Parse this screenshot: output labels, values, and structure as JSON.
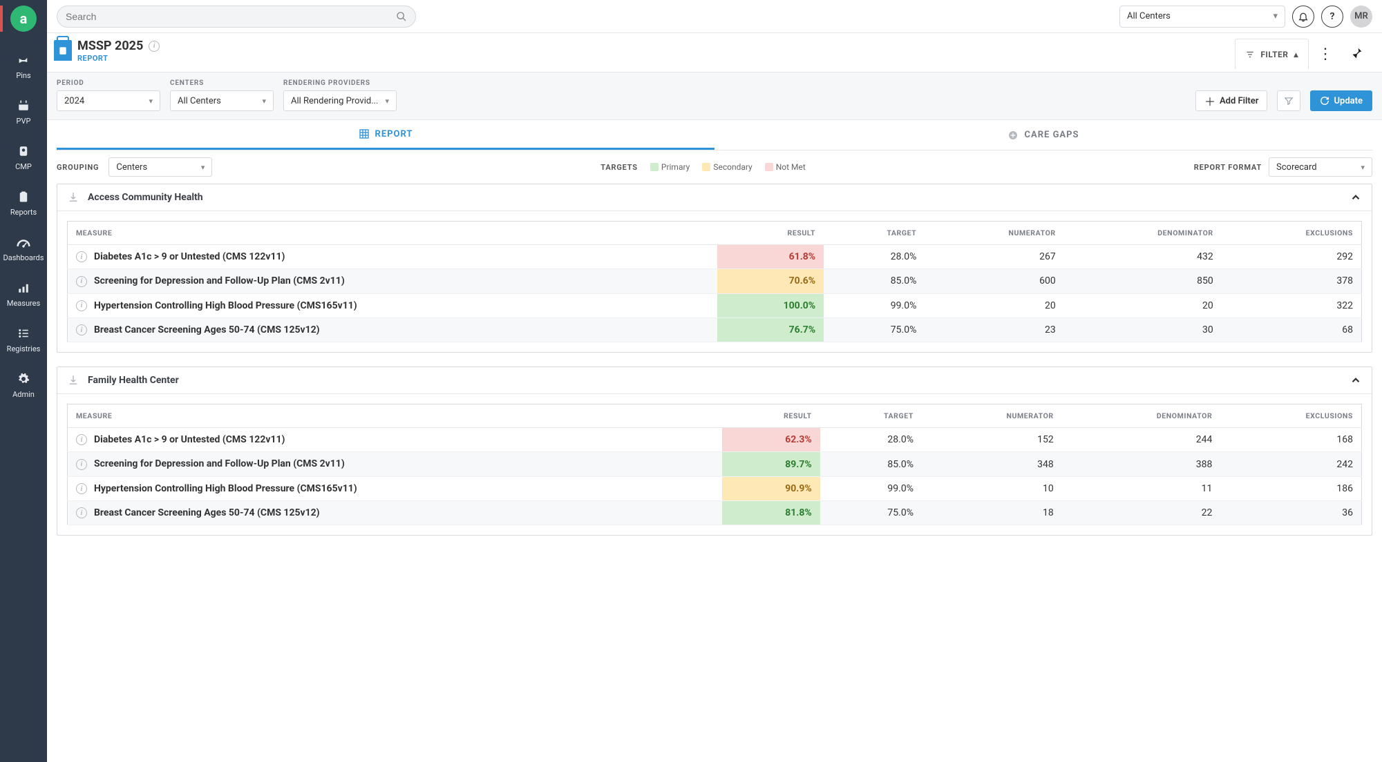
{
  "colors": {
    "primary": "#cfeccc",
    "secondary": "#fee8b6",
    "notmet": "#f9d7d6",
    "accent": "#2f93d8"
  },
  "sidebar": {
    "items": [
      {
        "label": "Pins"
      },
      {
        "label": "PVP"
      },
      {
        "label": "CMP"
      },
      {
        "label": "Reports"
      },
      {
        "label": "Dashboards"
      },
      {
        "label": "Measures"
      },
      {
        "label": "Registries"
      },
      {
        "label": "Admin"
      }
    ]
  },
  "topbar": {
    "search_placeholder": "Search",
    "center_select": "All Centers",
    "avatar": "MR"
  },
  "title": {
    "name": "MSSP 2025",
    "type": "REPORT",
    "filter_label": "FILTER"
  },
  "filters": {
    "period": {
      "label": "PERIOD",
      "value": "2024"
    },
    "centers": {
      "label": "CENTERS",
      "value": "All Centers"
    },
    "providers": {
      "label": "RENDERING PROVIDERS",
      "value": "All Rendering Provid..."
    },
    "add_filter": "Add Filter",
    "update": "Update"
  },
  "tabs": {
    "report": "REPORT",
    "care_gaps": "CARE GAPS"
  },
  "controls": {
    "grouping_label": "GROUPING",
    "grouping_value": "Centers",
    "targets_label": "TARGETS",
    "legend": {
      "primary": "Primary",
      "secondary": "Secondary",
      "notmet": "Not Met"
    },
    "format_label": "REPORT FORMAT",
    "format_value": "Scorecard"
  },
  "columns": {
    "measure": "MEASURE",
    "result": "RESULT",
    "target": "TARGET",
    "numerator": "NUMERATOR",
    "denominator": "DENOMINATOR",
    "exclusions": "EXCLUSIONS"
  },
  "groups": [
    {
      "name": "Access Community Health",
      "rows": [
        {
          "name": "Diabetes A1c > 9 or Untested (CMS 122v11)",
          "result": "61.8%",
          "status": "notmet",
          "target": "28.0%",
          "numerator": "267",
          "denominator": "432",
          "exclusions": "292"
        },
        {
          "name": "Screening for Depression and Follow-Up Plan (CMS 2v11)",
          "result": "70.6%",
          "status": "secondary",
          "target": "85.0%",
          "numerator": "600",
          "denominator": "850",
          "exclusions": "378"
        },
        {
          "name": "Hypertension Controlling High Blood Pressure (CMS165v11)",
          "result": "100.0%",
          "status": "primary",
          "target": "99.0%",
          "numerator": "20",
          "denominator": "20",
          "exclusions": "322"
        },
        {
          "name": "Breast Cancer Screening Ages 50-74 (CMS 125v12)",
          "result": "76.7%",
          "status": "primary",
          "target": "75.0%",
          "numerator": "23",
          "denominator": "30",
          "exclusions": "68"
        }
      ]
    },
    {
      "name": "Family Health Center",
      "rows": [
        {
          "name": "Diabetes A1c > 9 or Untested (CMS 122v11)",
          "result": "62.3%",
          "status": "notmet",
          "target": "28.0%",
          "numerator": "152",
          "denominator": "244",
          "exclusions": "168"
        },
        {
          "name": "Screening for Depression and Follow-Up Plan (CMS 2v11)",
          "result": "89.7%",
          "status": "primary",
          "target": "85.0%",
          "numerator": "348",
          "denominator": "388",
          "exclusions": "242"
        },
        {
          "name": "Hypertension Controlling High Blood Pressure (CMS165v11)",
          "result": "90.9%",
          "status": "secondary",
          "target": "99.0%",
          "numerator": "10",
          "denominator": "11",
          "exclusions": "186"
        },
        {
          "name": "Breast Cancer Screening Ages 50-74 (CMS 125v12)",
          "result": "81.8%",
          "status": "primary",
          "target": "75.0%",
          "numerator": "18",
          "denominator": "22",
          "exclusions": "36"
        }
      ]
    }
  ]
}
